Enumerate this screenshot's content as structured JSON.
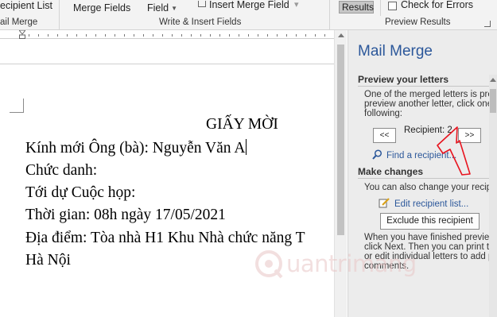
{
  "ribbon": {
    "recipient_list": "ecipient List",
    "merge_fields": "Merge Fields",
    "field": "Field",
    "insert_merge_field": "Insert Merge Field",
    "results": "Results",
    "check_for_errors": "Check for Errors",
    "group_start_mail_merge": "ail Merge",
    "group_write_insert": "Write & Insert Fields",
    "group_preview_results": "Preview Results"
  },
  "document": {
    "title": "GIẤY MỜI",
    "lines": [
      "Kính mới Ông (bà): Nguyễn Văn A",
      "Chức danh:",
      "Tới dự Cuộc họp:",
      "Thời gian: 08h ngày 17/05/2021",
      "Địa điểm: Tòa nhà H1 Khu Nhà chức năng T",
      "Hà Nội"
    ]
  },
  "pane": {
    "title": "Mail Merge",
    "preview_heading": "Preview your letters",
    "preview_text": [
      "One of the merged letters is prev",
      "preview another letter, click one",
      "following:"
    ],
    "prev_button": "<<",
    "recipient_label": "Recipient: 2",
    "next_button": ">>",
    "find_recipient": "Find a recipient...",
    "changes_heading": "Make changes",
    "changes_text": "You can also change your recipie",
    "edit_list": "Edit recipient list...",
    "exclude_button": "Exclude this recipient",
    "finish_text": [
      "When you have finished preview",
      "click Next. Then you can print th",
      "or edit individual letters to add p",
      "comments."
    ]
  },
  "watermark": {
    "text": "uantrimang"
  },
  "colors": {
    "accent": "#2b579a",
    "annotation": "#e8141f",
    "pane_bg": "#ececec"
  },
  "icons": [
    "checkbox-icon",
    "search-icon",
    "edit-icon",
    "watermark-logo-icon",
    "dropdown-caret-icon"
  ]
}
